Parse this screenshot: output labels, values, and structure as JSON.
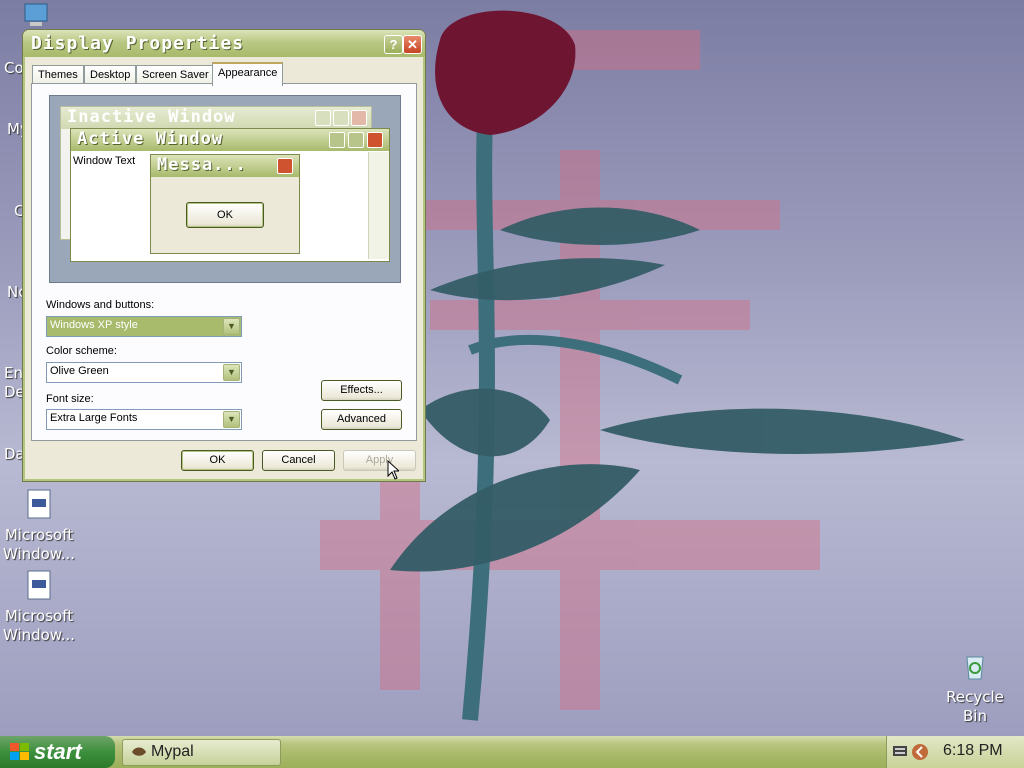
{
  "desktop": {
    "icons": [
      {
        "label": "Microsoft Window..."
      },
      {
        "label": "Microsoft Window..."
      },
      {
        "label": "Recycle Bin"
      }
    ],
    "partial_labels": [
      "Co",
      "My",
      "C",
      "No",
      "En",
      "De",
      "Da"
    ]
  },
  "dialog": {
    "title": "Display Properties",
    "help_label": "?",
    "close_label": "✕",
    "tabs": [
      {
        "label": "Themes"
      },
      {
        "label": "Desktop"
      },
      {
        "label": "Screen Saver"
      },
      {
        "label": "Appearance",
        "active": true
      }
    ],
    "preview": {
      "inactive_title": "Inactive Window",
      "active_title": "Active Window",
      "window_text": "Window Text",
      "message_title": "Messa...",
      "ok_label": "OK"
    },
    "windows_and_buttons": {
      "label": "Windows and buttons:",
      "value": "Windows XP style"
    },
    "color_scheme": {
      "label": "Color scheme:",
      "value": "Olive Green"
    },
    "font_size": {
      "label": "Font size:",
      "value": "Extra Large Fonts"
    },
    "effects_label": "Effects...",
    "advanced_label": "Advanced",
    "ok_label": "OK",
    "cancel_label": "Cancel",
    "apply_label": "Apply"
  },
  "taskbar": {
    "start_label": "start",
    "tasks": [
      {
        "label": "Mypal"
      }
    ],
    "clock": "6:18 PM"
  },
  "colors": {
    "title_olive": "#a8ba6b",
    "start_green": "#3c8f3c",
    "taskbar_olive": "#b8c57f"
  }
}
